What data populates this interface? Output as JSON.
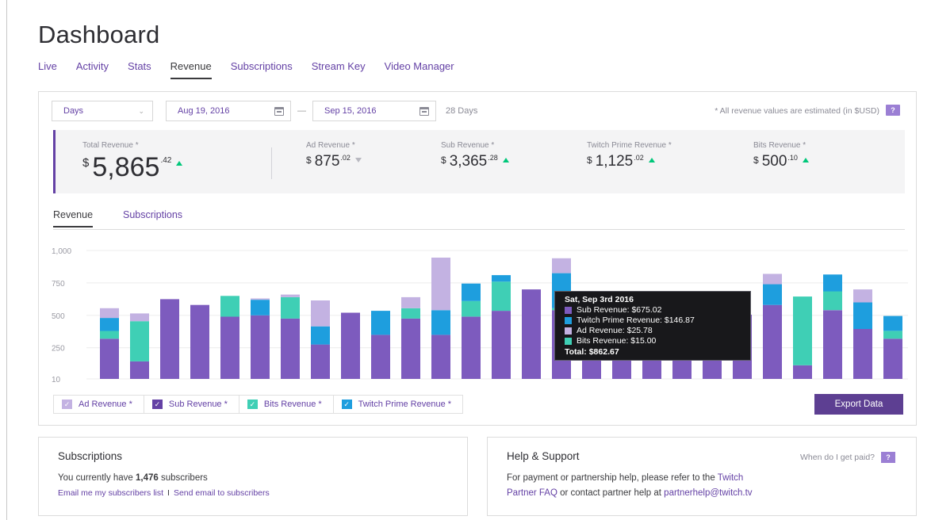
{
  "page": {
    "title": "Dashboard"
  },
  "nav": [
    {
      "label": "Live",
      "active": false
    },
    {
      "label": "Activity",
      "active": false
    },
    {
      "label": "Stats",
      "active": false
    },
    {
      "label": "Revenue",
      "active": true
    },
    {
      "label": "Subscriptions",
      "active": false
    },
    {
      "label": "Stream Key",
      "active": false
    },
    {
      "label": "Video Manager",
      "active": false
    }
  ],
  "filters": {
    "period": "Days",
    "start_date": "Aug 19, 2016",
    "separator": "—",
    "end_date": "Sep 15, 2016",
    "days_count": "28 Days",
    "note": "* All revenue values are estimated (in $USD)",
    "help": "?"
  },
  "summary": {
    "currency": "$",
    "total": {
      "label": "Total Revenue *",
      "value": "5,865",
      "cents": ".42",
      "trend": "up"
    },
    "ad": {
      "label": "Ad Revenue *",
      "value": "875",
      "cents": ".02",
      "trend": "down"
    },
    "sub": {
      "label": "Sub Revenue *",
      "value": "3,365",
      "cents": ".28",
      "trend": "up"
    },
    "prime": {
      "label": "Twitch Prime Revenue *",
      "value": "1,125",
      "cents": ".02",
      "trend": "up"
    },
    "bits": {
      "label": "Bits Revenue *",
      "value": "500",
      "cents": ".10",
      "trend": "up"
    }
  },
  "chart_tabs": [
    {
      "label": "Revenue",
      "active": true
    },
    {
      "label": "Subscriptions",
      "active": false
    }
  ],
  "colors": {
    "sub": "#7d5bbe",
    "prime": "#1e9ede",
    "ad": "#c3b2e2",
    "bits": "#3fcfb5",
    "accent": "#6441a5"
  },
  "chart_data": {
    "type": "bar",
    "stacked": true,
    "yticks": [
      "1,000",
      "750",
      "500",
      "250",
      "10"
    ],
    "ylim": [
      10,
      1000
    ],
    "grid": true,
    "series": [
      {
        "name": "Sub Revenue",
        "key": "sub",
        "values": [
          310,
          135,
          615,
          570,
          480,
          490,
          465,
          265,
          510,
          340,
          465,
          340,
          480,
          525,
          690,
          530,
          545,
          510,
          490,
          490,
          495,
          495,
          570,
          105,
          530,
          385,
          310
        ]
      },
      {
        "name": "Bits Revenue",
        "key": "bits",
        "values": [
          60,
          310,
          0,
          0,
          160,
          0,
          165,
          0,
          0,
          0,
          80,
          0,
          120,
          225,
          0,
          15,
          0,
          0,
          0,
          0,
          0,
          0,
          0,
          530,
          145,
          0,
          60
        ]
      },
      {
        "name": "Twitch Prime Revenue",
        "key": "prime",
        "values": [
          100,
          0,
          0,
          0,
          0,
          120,
          0,
          140,
          0,
          185,
          0,
          190,
          135,
          50,
          0,
          270,
          0,
          0,
          0,
          0,
          0,
          0,
          160,
          0,
          130,
          205,
          115
        ]
      },
      {
        "name": "Ad Revenue",
        "key": "ad",
        "values": [
          75,
          60,
          0,
          0,
          0,
          10,
          20,
          200,
          0,
          0,
          85,
          405,
          0,
          0,
          0,
          115,
          0,
          0,
          0,
          0,
          0,
          0,
          80,
          0,
          0,
          100,
          0
        ]
      }
    ],
    "tooltip": {
      "title": "Sat, Sep 3rd 2016",
      "rows": [
        {
          "key": "sub",
          "text": "Sub Revenue: $675.02"
        },
        {
          "key": "prime",
          "text": "Twitch Prime Revenue: $146.87"
        },
        {
          "key": "ad",
          "text": "Ad Revenue: $25.78"
        },
        {
          "key": "bits",
          "text": "Bits Revenue: $15.00"
        }
      ],
      "total": "Total: $862.67"
    }
  },
  "legend": [
    {
      "label": "Ad Revenue *",
      "key": "ad",
      "checked": true
    },
    {
      "label": "Sub Revenue *",
      "key": "sub",
      "checked": true
    },
    {
      "label": "Bits Revenue *",
      "key": "bits",
      "checked": true
    },
    {
      "label": "Twitch Prime Revenue *",
      "key": "prime",
      "checked": true
    }
  ],
  "export_label": "Export Data",
  "subscriptions_card": {
    "title": "Subscriptions",
    "text_prefix": "You currently have ",
    "count": "1,476",
    "text_suffix": " subscribers",
    "link1": "Email me my subscribers list",
    "link_sep": "I",
    "link2": "Send email to subscribers"
  },
  "help_card": {
    "title": "Help & Support",
    "when_paid": "When do I get paid?",
    "help": "?",
    "line1_prefix": "For payment or partnership help, please refer to the ",
    "line1_link": "Twitch",
    "line2_link": "Partner FAQ",
    "line2_mid": " or contact partner help at ",
    "email": "partnerhelp@twitch.tv"
  }
}
